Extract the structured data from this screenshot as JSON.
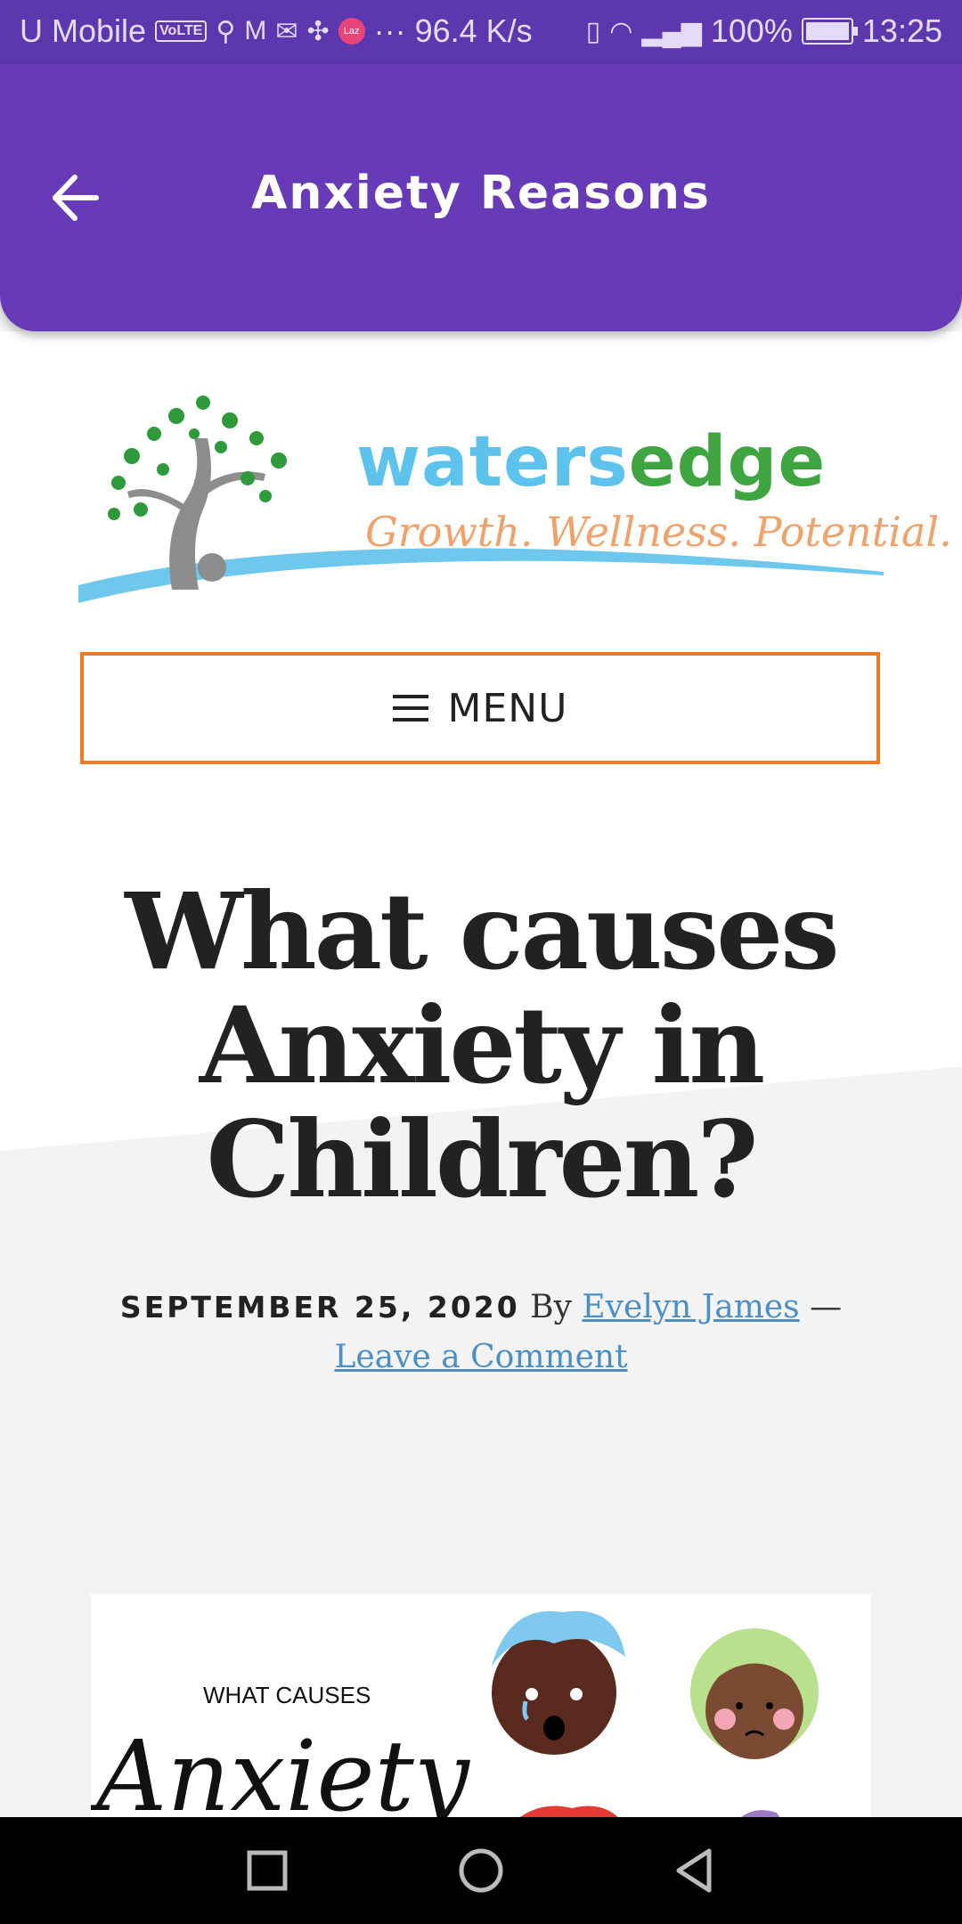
{
  "status_bar": {
    "carrier": "U Mobile",
    "volte": "VoLTE",
    "laz": "Laz",
    "speed": "··· 96.4 K/s",
    "battery": "100%",
    "time": "13:25"
  },
  "app_bar": {
    "title": "Anxiety Reasons",
    "color": "#673ab7"
  },
  "logo": {
    "word_part1": "waters",
    "word_part2": "edge",
    "tagline": "Growth. Wellness. Potential."
  },
  "menu": {
    "label": "MENU",
    "border_color": "#f07b22"
  },
  "post": {
    "title": "What causes Anxiety in Children?",
    "date": "SEPTEMBER 25, 2020",
    "by": "By",
    "author": "Evelyn James",
    "dash": "—",
    "comment_link": "Leave a Comment",
    "image_small_text": "WHAT CAUSES",
    "image_script_text": "Anxiety"
  },
  "nav": {
    "icons": [
      "recent-apps-icon",
      "home-icon",
      "back-icon"
    ]
  }
}
